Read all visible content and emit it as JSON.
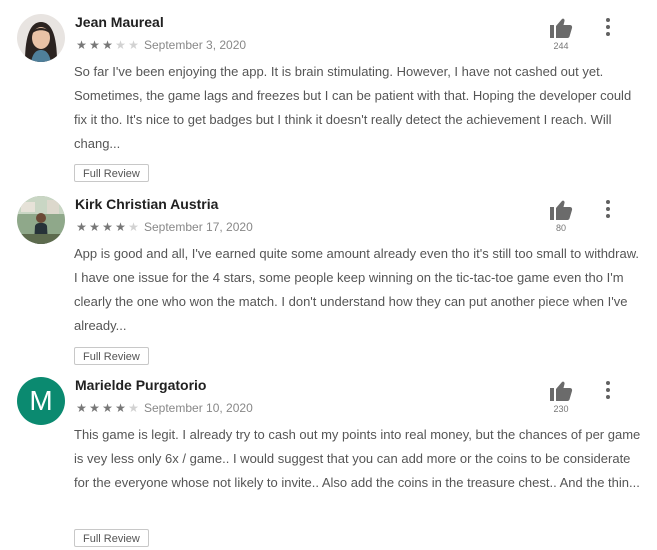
{
  "reviews": [
    {
      "name": "Jean Maureal",
      "rating": 3,
      "max_rating": 5,
      "date": "September 3, 2020",
      "likes": "244",
      "avatar": {
        "type": "photo",
        "icon": "user-photo"
      },
      "text": "So far I've been enjoying the app. It is brain stimulating. However, I have not cashed out yet. Sometimes, the game lags and freezes but I can be patient with that. Hoping the developer could fix it tho. It's nice to get badges but I think it doesn't really detect the achievement I reach. Will chang...",
      "full_review_label": "Full Review"
    },
    {
      "name": "Kirk Christian Austria",
      "rating": 4,
      "max_rating": 5,
      "date": "September 17, 2020",
      "likes": "80",
      "avatar": {
        "type": "photo",
        "icon": "user-photo"
      },
      "text": "App is good and all, I've earned quite some amount already even tho it's still too small to withdraw. I have one issue for the 4 stars, some people keep winning on the tic-tac-toe game even tho I'm clearly the one who won the match. I don't understand how they can put another piece when I've already...",
      "full_review_label": "Full Review"
    },
    {
      "name": "Marielde Purgatorio",
      "rating": 4,
      "max_rating": 5,
      "date": "September 10, 2020",
      "likes": "230",
      "avatar": {
        "type": "letter",
        "letter": "M",
        "color": "#0b8a70"
      },
      "text": "This game is legit. I already try to cash out my points into real money, but the chances of per game is vey less only 6x / game.. I would suggest that you can add more or the coins to be considerate for the everyone whose not likely to invite.. Also add the coins in the treasure chest.. And the thin...",
      "full_review_label": "Full Review"
    }
  ],
  "icons": {
    "helpful": "thumbs-up-icon",
    "more": "more-vert-icon",
    "star": "star-icon"
  },
  "colors": {
    "star_filled": "#777777",
    "star_empty": "#d2d2d2",
    "avatar_letter_bg": "#0b8a70"
  }
}
